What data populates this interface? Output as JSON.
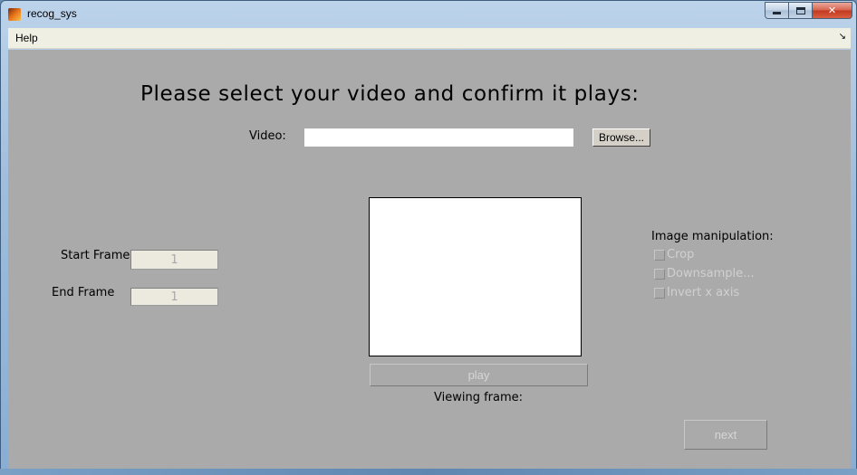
{
  "window": {
    "title": "recog_sys",
    "icon": "matlab-icon"
  },
  "menu": {
    "items": [
      {
        "label": "Help"
      }
    ],
    "dock_glyph": "↘"
  },
  "main": {
    "headline": "Please select your video and confirm it plays:",
    "video": {
      "label": "Video:",
      "value": "",
      "browse_label": "Browse..."
    },
    "start_frame": {
      "label": "Start Frame",
      "value": "1"
    },
    "end_frame": {
      "label": "End Frame",
      "value": "1"
    },
    "play_label": "play",
    "viewing_frame_label": "Viewing frame:",
    "image_manipulation": {
      "title": "Image manipulation:",
      "options": [
        {
          "label": "Crop",
          "checked": false,
          "enabled": false
        },
        {
          "label": "Downsample...",
          "checked": false,
          "enabled": false
        },
        {
          "label": "Invert x axis",
          "checked": false,
          "enabled": false
        }
      ]
    },
    "next_label": "next"
  },
  "colors": {
    "figure_bg": "#aaaaaa",
    "menubar_bg": "#f0efe4",
    "disabled_text": "#d0d0d0"
  }
}
